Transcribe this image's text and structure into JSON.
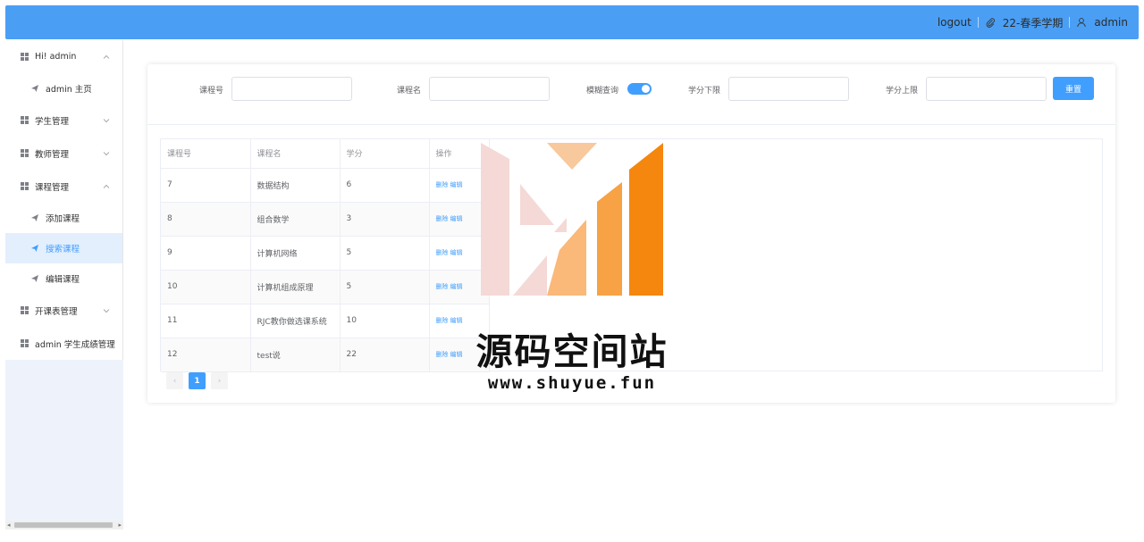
{
  "header": {
    "logout": "logout",
    "semester": "22-春季学期",
    "username": "admin"
  },
  "sidebar": {
    "items": [
      {
        "label": "Hi! admin",
        "type": "group",
        "expanded": true,
        "icon": "grid-icon"
      },
      {
        "label": "admin 主页",
        "type": "sub",
        "icon": "send-icon"
      },
      {
        "label": "学生管理",
        "type": "group",
        "expanded": false,
        "icon": "grid-icon"
      },
      {
        "label": "教师管理",
        "type": "group",
        "expanded": false,
        "icon": "grid-icon"
      },
      {
        "label": "课程管理",
        "type": "group",
        "expanded": true,
        "icon": "grid-icon"
      },
      {
        "label": "添加课程",
        "type": "sub",
        "icon": "send-icon"
      },
      {
        "label": "搜索课程",
        "type": "sub",
        "active": true,
        "icon": "send-icon"
      },
      {
        "label": "编辑课程",
        "type": "sub",
        "icon": "send-icon"
      },
      {
        "label": "开课表管理",
        "type": "group",
        "expanded": false,
        "icon": "grid-icon"
      },
      {
        "label": "admin 学生成绩管理",
        "type": "group",
        "icon": "grid-icon"
      }
    ]
  },
  "search": {
    "course_no_label": "课程号",
    "course_name_label": "课程名",
    "fuzzy_label": "模糊查询",
    "fuzzy_on": true,
    "credit_min_label": "学分下限",
    "credit_max_label": "学分上限",
    "reset_label": "重置"
  },
  "table": {
    "headers": [
      "课程号",
      "课程名",
      "学分",
      "操作"
    ],
    "rows": [
      {
        "id": "7",
        "name": "数据结构",
        "credit": "6"
      },
      {
        "id": "8",
        "name": "组合数学",
        "credit": "3"
      },
      {
        "id": "9",
        "name": "计算机网络",
        "credit": "5"
      },
      {
        "id": "10",
        "name": "计算机组成原理",
        "credit": "5"
      },
      {
        "id": "11",
        "name": "RJC教你做选课系统",
        "credit": "10"
      },
      {
        "id": "12",
        "name": "test说",
        "credit": "22"
      }
    ],
    "delete_label": "删除",
    "edit_label": "编辑"
  },
  "pagination": {
    "prev": "‹",
    "current": "1",
    "next": "›"
  },
  "watermark": {
    "title": "源码空间站",
    "url": "www.shuyue.fun"
  },
  "colors": {
    "header_bg": "#4a9ff5",
    "accent": "#409eff",
    "active_item_bg": "#e3effd"
  }
}
